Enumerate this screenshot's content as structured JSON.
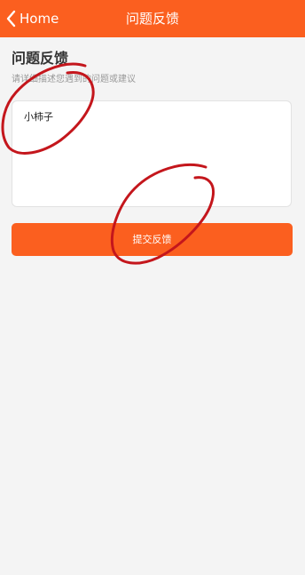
{
  "navbar": {
    "back_label": "Home",
    "title": "问题反馈",
    "background": "#fb5f1f"
  },
  "form": {
    "section_title": "问题反馈",
    "hint": "请详细描述您遇到的问题或建议",
    "textarea_value": "小柿子"
  },
  "actions": {
    "submit_label": "提交反馈"
  },
  "colors": {
    "accent": "#fb5f1f",
    "annotation": "#c4161c",
    "page_background": "#f4f4f4"
  },
  "icons": {
    "back": "chevron-left-icon"
  }
}
